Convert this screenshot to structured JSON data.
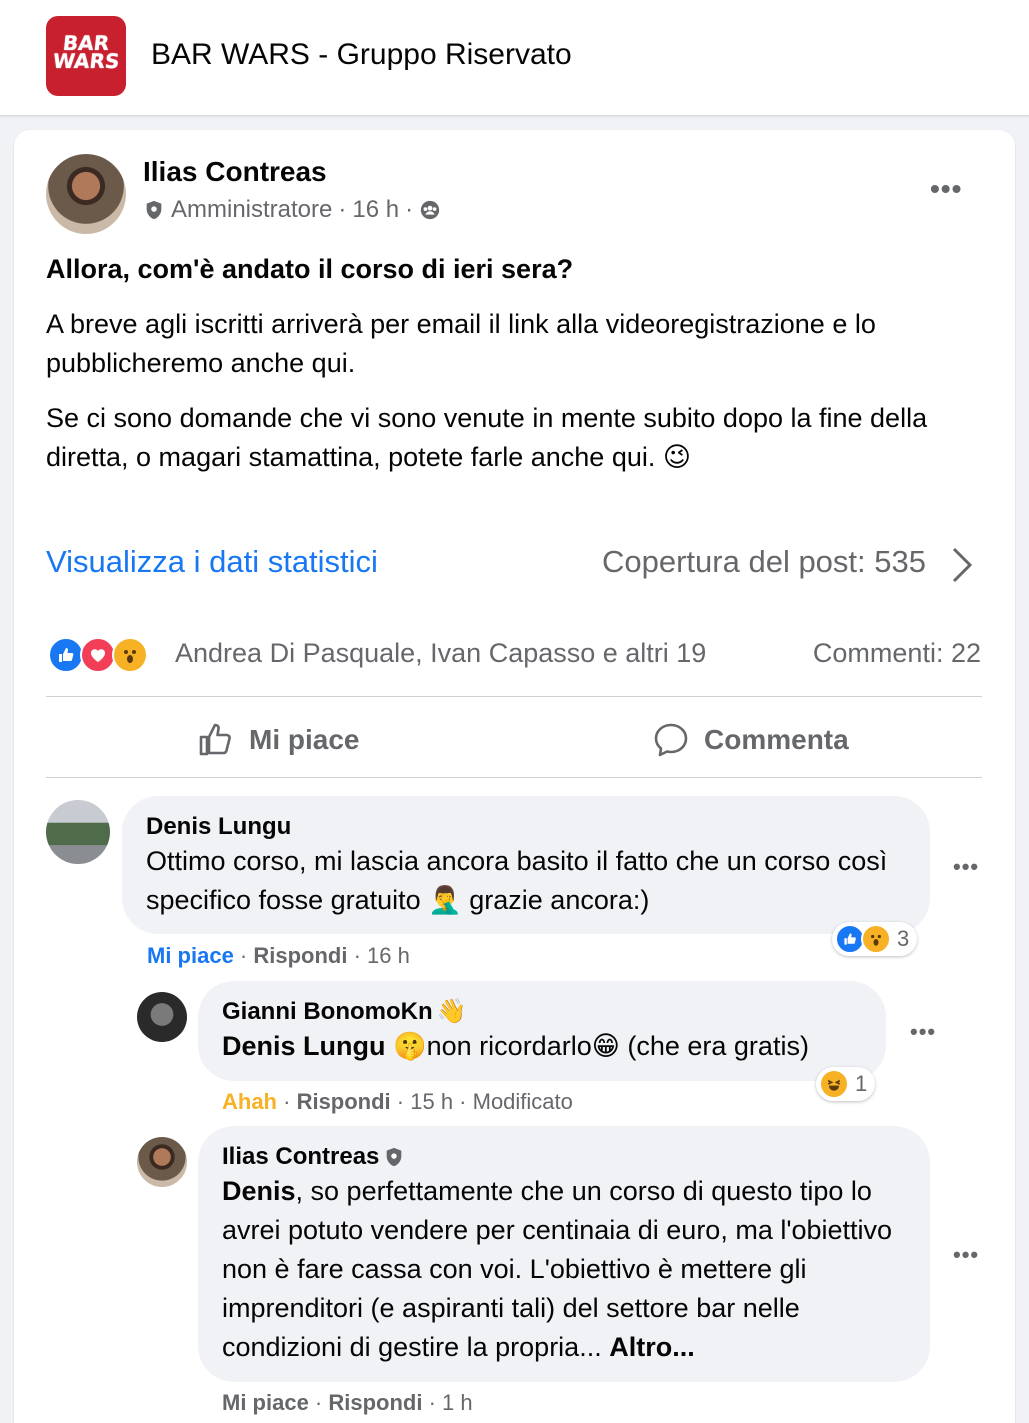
{
  "group": {
    "logo_line1": "BAR",
    "logo_line2": "WARS",
    "title": "BAR WARS - Gruppo Riservato"
  },
  "post": {
    "author": "Ilias Contreas",
    "role": "Amministratore",
    "time": "16 h",
    "headline": "Allora, com'è andato il corso di ieri sera?",
    "paragraph1": "A breve agli iscritti arriverà per email il link alla videoregistrazione e lo pubblicheremo anche qui.",
    "paragraph2": "Se ci sono domande che vi sono venute in mente subito dopo la fine della diretta, o magari stamattina, potete farle anche qui. 😉",
    "stats_link": "Visualizza i dati statistici",
    "reach": "Copertura del post: 535",
    "reactions_names": "Andrea Di Pasquale, Ivan Capasso e altri 19",
    "comments_count": "Commenti: 22",
    "like_label": "Mi piace",
    "comment_label": "Commenta"
  },
  "comments": [
    {
      "name": "Denis Lungu",
      "text": "Ottimo corso, mi lascia ancora basito il fatto che un corso così specifico fosse gratuito 🤦‍♂️ grazie ancora:)",
      "action1": "Mi piace",
      "reply": "Rispondi",
      "time": "16 h",
      "reaction_count": "3"
    },
    {
      "name": "Gianni BonomoKn",
      "name_emoji": "👋",
      "mention": "Denis Lungu",
      "text": "🤫non ricordarlo😁 (che era gratis)",
      "action1": "Ahah",
      "reply": "Rispondi",
      "time": "15 h",
      "edited": "Modificato",
      "reaction_count": "1"
    },
    {
      "name": "Ilias Contreas",
      "mention": "Denis",
      "text": ", so perfettamente che un corso di questo tipo lo avrei potuto vendere per centinaia di euro, ma l'obiettivo non è fare cassa con voi. L'obiettivo è mettere gli imprenditori (e aspiranti tali) del settore bar nelle condizioni di gestire la propria... ",
      "more": "Altro...",
      "action1": "Mi piace",
      "reply": "Rispondi",
      "time": "1 h"
    }
  ],
  "colors": {
    "accent": "#1877f2",
    "brand": "#c8202f",
    "muted": "#65676b",
    "bubble": "#f0f2f5",
    "ahah": "#f7b125"
  }
}
